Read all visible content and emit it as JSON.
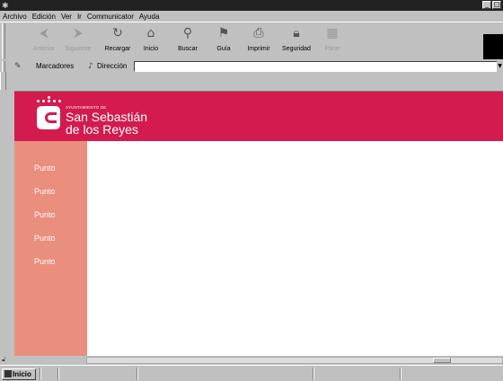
{
  "window": {
    "minimize_glyph": "_",
    "maximize_glyph": "□"
  },
  "menu": {
    "items": [
      "Archivo",
      "Edición",
      "Ver",
      "Ir",
      "Communicator",
      "Ayuda"
    ]
  },
  "toolbar": {
    "buttons": [
      {
        "label": "Anterior",
        "icon": "back-arrow-icon",
        "enabled": false
      },
      {
        "label": "Siguiente",
        "icon": "forward-arrow-icon",
        "enabled": false
      },
      {
        "label": "Recargar",
        "icon": "reload-icon",
        "enabled": true
      },
      {
        "label": "Inicio",
        "icon": "home-icon",
        "enabled": true
      },
      {
        "label": "Buscar",
        "icon": "search-icon",
        "enabled": true
      },
      {
        "label": "Guía",
        "icon": "guide-icon",
        "enabled": true
      },
      {
        "label": "Imprimir",
        "icon": "print-icon",
        "enabled": true
      },
      {
        "label": "Seguridad",
        "icon": "security-lock-icon",
        "enabled": true
      },
      {
        "label": "Parar",
        "icon": "stop-icon",
        "enabled": false
      }
    ]
  },
  "location": {
    "bookmarks_label": "Marcadores",
    "address_label": "Dirección",
    "address_value": ""
  },
  "page": {
    "logo": {
      "small_text": "AYUNTAMIENTO DE",
      "line1": "San Sebastián",
      "line2": "de los Reyes"
    },
    "nav": [
      "Punto",
      "Punto",
      "Punto",
      "Punto",
      "Punto"
    ]
  },
  "taskbar": {
    "start_label": "Inicio"
  },
  "colors": {
    "banner": "#d31b4e",
    "sidebar": "#ea8e7d",
    "chrome": "#c0c0c0",
    "titlebar": "#222222"
  }
}
